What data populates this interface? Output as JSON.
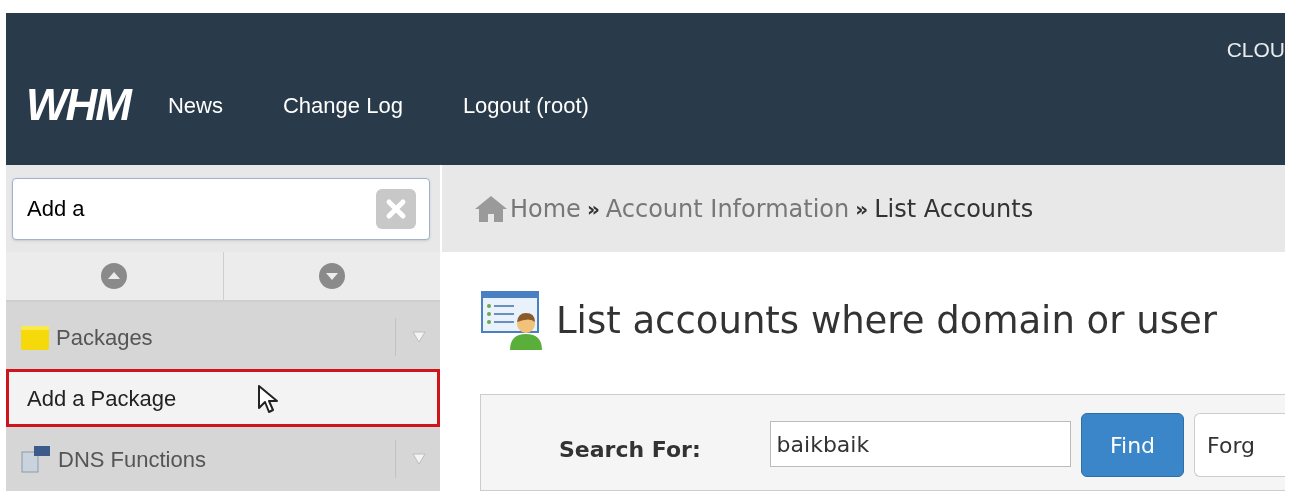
{
  "header": {
    "logo": "WHM",
    "top_right": "CLOU",
    "nav": [
      "News",
      "Change Log",
      "Logout (root)"
    ]
  },
  "sidebar": {
    "search": {
      "value": "Add a"
    },
    "groups": [
      {
        "label": "Packages",
        "kind": "package",
        "children": [
          {
            "label": "Add a Package",
            "selected": true
          }
        ]
      },
      {
        "label": "DNS Functions",
        "kind": "dns"
      }
    ]
  },
  "breadcrumb": [
    {
      "label": "Home",
      "separator": "»",
      "current": false
    },
    {
      "label": "Account Information",
      "separator": "»",
      "current": false
    },
    {
      "label": "List Accounts",
      "current": true
    }
  ],
  "main": {
    "heading": "List accounts where domain or user",
    "search_form": {
      "label": "Search For:",
      "value": "baikbaik",
      "buttons": [
        {
          "label": "Find",
          "kind": "primary"
        },
        {
          "label": "Forg",
          "kind": "default"
        }
      ]
    }
  }
}
